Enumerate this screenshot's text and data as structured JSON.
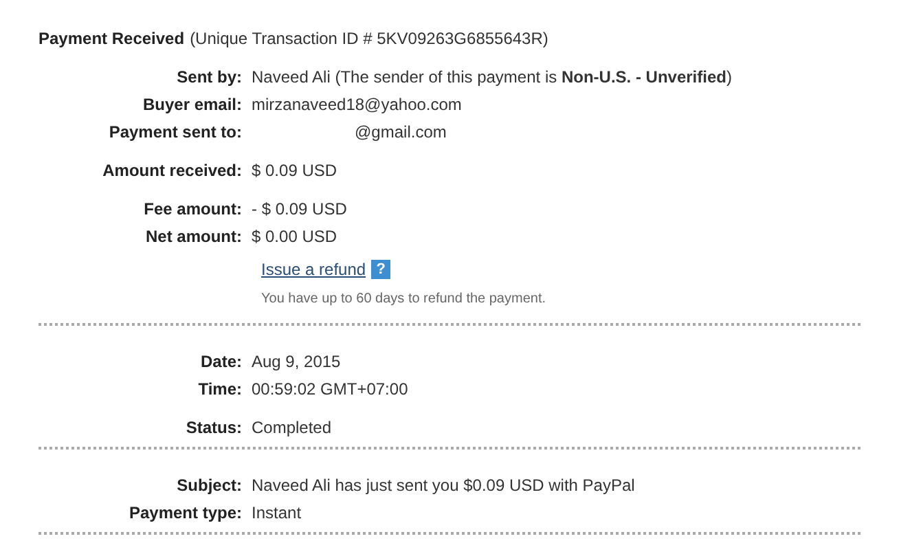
{
  "title": {
    "heading": "Payment Received",
    "detail": "(Unique Transaction ID # 5KV09263G6855643R)"
  },
  "sections": [
    {
      "groups": [
        [
          {
            "label": "Sent by:",
            "value": "Naveed Ali (The sender of this payment is **Non-U.S. - Unverified**)"
          },
          {
            "label": "Buyer email:",
            "value": "mirzanaveed18@yahoo.com"
          },
          {
            "label": "Payment sent to:",
            "value": "@gmail.com",
            "redacted": true
          }
        ],
        [
          {
            "label": "Amount received:",
            "value": "$ 0.09 USD"
          }
        ],
        [
          {
            "label": "Fee amount:",
            "value": "- $ 0.09 USD"
          },
          {
            "label": "Net amount:",
            "value": "$ 0.00 USD"
          }
        ]
      ],
      "refund": {
        "link": "Issue a refund",
        "help": "?",
        "note": "You have up to 60 days to refund the payment."
      }
    },
    {
      "groups": [
        [
          {
            "label": "Date:",
            "value": "Aug 9, 2015"
          },
          {
            "label": "Time:",
            "value": "00:59:02 GMT+07:00"
          }
        ],
        [
          {
            "label": "Status:",
            "value": "Completed"
          }
        ]
      ]
    },
    {
      "groups": [
        [
          {
            "label": "Subject:",
            "value": "Naveed Ali has just sent you $0.09 USD with PayPal"
          },
          {
            "label": "Payment type:",
            "value": "Instant"
          }
        ]
      ]
    }
  ]
}
